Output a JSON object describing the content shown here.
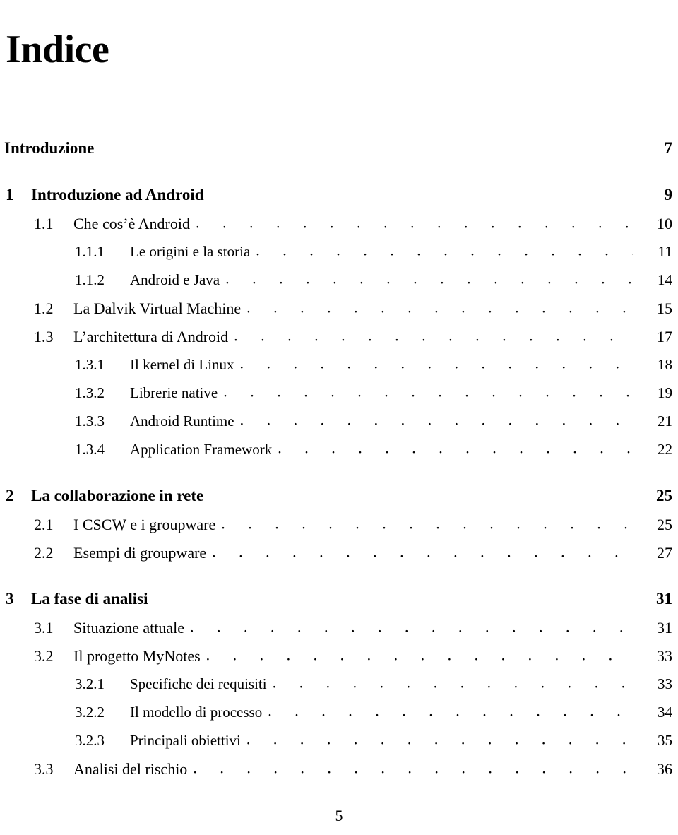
{
  "document": {
    "title": "Indice",
    "folio": "5",
    "leader_dots": ". . . . . . . . . . . . . . . . . . . . . . . . . . . . . . . . . . . . . . . . . . . . ."
  },
  "entries": [
    {
      "level": 0,
      "number": "",
      "label": "Introduzione",
      "page": "7",
      "leader": false,
      "spaced": false
    },
    {
      "level": 0,
      "number": "1",
      "label": "Introduzione ad Android",
      "page": "9",
      "leader": false,
      "spaced": true
    },
    {
      "level": 1,
      "number": "1.1",
      "label": "Che cos’è Android",
      "page": "10",
      "leader": true,
      "spaced": false
    },
    {
      "level": 2,
      "number": "1.1.1",
      "label": "Le origini e la storia",
      "page": "11",
      "leader": true,
      "spaced": false
    },
    {
      "level": 2,
      "number": "1.1.2",
      "label": "Android e Java",
      "page": "14",
      "leader": true,
      "spaced": false
    },
    {
      "level": 1,
      "number": "1.2",
      "label": "La Dalvik Virtual Machine",
      "page": "15",
      "leader": true,
      "spaced": false
    },
    {
      "level": 1,
      "number": "1.3",
      "label": "L’architettura di Android",
      "page": "17",
      "leader": true,
      "spaced": false
    },
    {
      "level": 2,
      "number": "1.3.1",
      "label": "Il kernel di Linux",
      "page": "18",
      "leader": true,
      "spaced": false
    },
    {
      "level": 2,
      "number": "1.3.2",
      "label": "Librerie native",
      "page": "19",
      "leader": true,
      "spaced": false
    },
    {
      "level": 2,
      "number": "1.3.3",
      "label": "Android Runtime",
      "page": "21",
      "leader": true,
      "spaced": false
    },
    {
      "level": 2,
      "number": "1.3.4",
      "label": "Application Framework",
      "page": "22",
      "leader": true,
      "spaced": false
    },
    {
      "level": 0,
      "number": "2",
      "label": "La collaborazione in rete",
      "page": "25",
      "leader": false,
      "spaced": true
    },
    {
      "level": 1,
      "number": "2.1",
      "label": "I CSCW e i groupware",
      "page": "25",
      "leader": true,
      "spaced": false
    },
    {
      "level": 1,
      "number": "2.2",
      "label": "Esempi di groupware",
      "page": "27",
      "leader": true,
      "spaced": false
    },
    {
      "level": 0,
      "number": "3",
      "label": "La fase di analisi",
      "page": "31",
      "leader": false,
      "spaced": true
    },
    {
      "level": 1,
      "number": "3.1",
      "label": "Situazione attuale",
      "page": "31",
      "leader": true,
      "spaced": false
    },
    {
      "level": 1,
      "number": "3.2",
      "label": "Il progetto MyNotes",
      "page": "33",
      "leader": true,
      "spaced": false
    },
    {
      "level": 2,
      "number": "3.2.1",
      "label": "Specifiche dei requisiti",
      "page": "33",
      "leader": true,
      "spaced": false
    },
    {
      "level": 2,
      "number": "3.2.2",
      "label": "Il modello di processo",
      "page": "34",
      "leader": true,
      "spaced": false
    },
    {
      "level": 2,
      "number": "3.2.3",
      "label": "Principali obiettivi",
      "page": "35",
      "leader": true,
      "spaced": false
    },
    {
      "level": 1,
      "number": "3.3",
      "label": "Analisi del rischio",
      "page": "36",
      "leader": true,
      "spaced": false
    }
  ]
}
